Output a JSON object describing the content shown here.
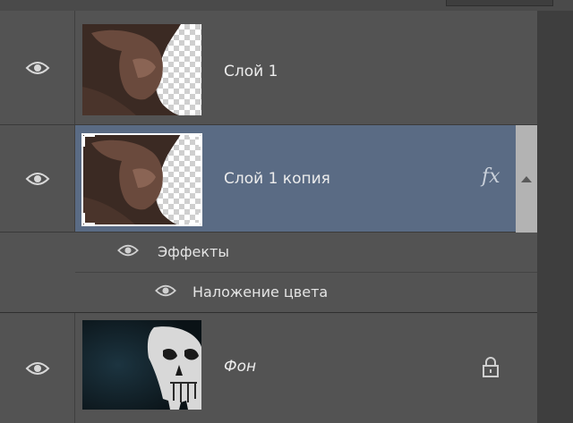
{
  "panel": "layers",
  "layers": [
    {
      "name": "Слой 1",
      "selected": false,
      "visible": true
    },
    {
      "name": "Слой 1 копия",
      "selected": true,
      "visible": true,
      "fx_badge": "fx",
      "effects_label": "Эффекты",
      "effects": [
        {
          "name": "Наложение цвета",
          "visible": true
        }
      ]
    },
    {
      "name": "Фон",
      "selected": false,
      "visible": true,
      "locked": true
    }
  ],
  "colors": {
    "panel_bg": "#535353",
    "selected_bg": "#5a6b84",
    "scrollbar": "#b3b3b3"
  },
  "icons": {
    "visibility": "eye-icon",
    "lock": "lock-icon",
    "effects": "fx-icon"
  }
}
